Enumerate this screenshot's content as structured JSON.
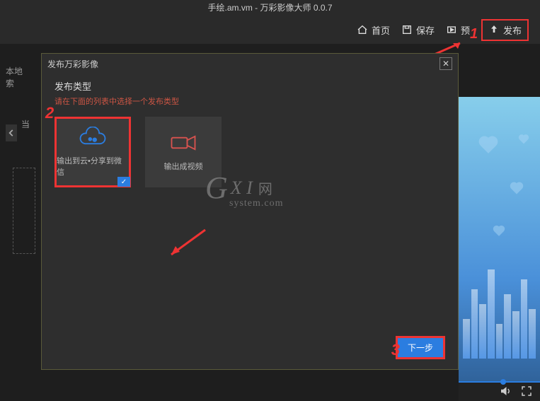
{
  "titlebar": "手绘.am.vm - 万彩影像大师 0.0.7",
  "toolbar": {
    "home": "首页",
    "save": "保存",
    "preview": "预",
    "publish": "发布"
  },
  "sidebar": {
    "local": "本地索",
    "back_prefix": "当"
  },
  "modal": {
    "title": "发布万彩影像",
    "section_title": "发布类型",
    "section_hint": "请在下面的列表中选择一个发布类型",
    "option_cloud": "输出到云•分享到微信",
    "option_video": "输出成视频",
    "next": "下一步"
  },
  "callouts": {
    "n1": "1",
    "n2": "2",
    "n3": "3"
  },
  "watermark": {
    "g": "G",
    "xi": "X I",
    "cn": "网",
    "sub": "system.com"
  }
}
